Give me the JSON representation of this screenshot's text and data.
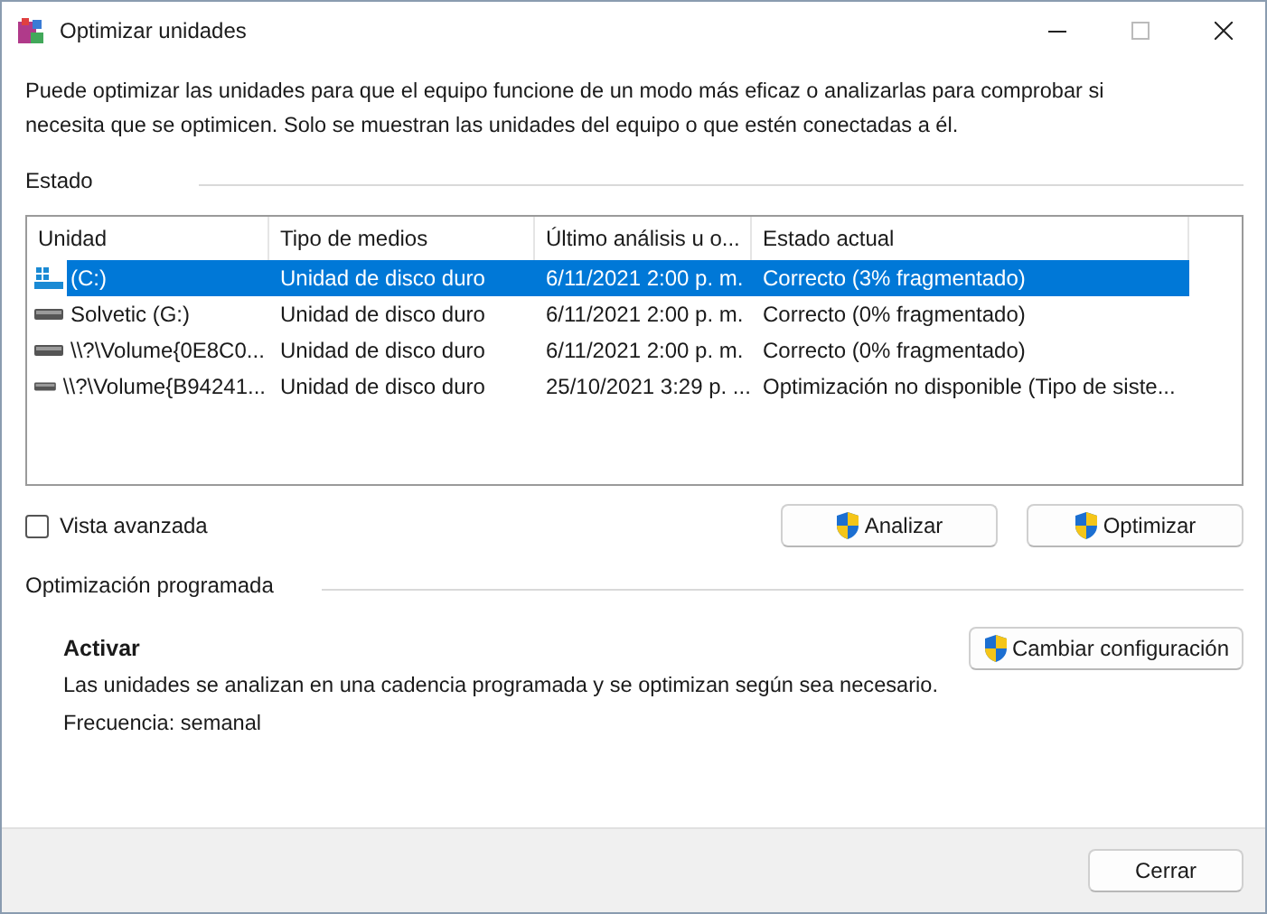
{
  "window": {
    "title": "Optimizar unidades"
  },
  "description": "Puede optimizar las unidades para que el equipo funcione de un modo más eficaz o analizarlas para comprobar si necesita que se optimicen. Solo se muestran las unidades del equipo o que estén conectadas a él.",
  "status_section": {
    "title": "Estado",
    "table": {
      "columns": [
        "Unidad",
        "Tipo de medios",
        "Último análisis u o...",
        "Estado actual"
      ],
      "rows": [
        {
          "kind": "system",
          "selected": true,
          "cells": [
            "(C:)",
            "Unidad de disco duro",
            "6/11/2021 2:00 p. m.",
            "Correcto (3% fragmentado)"
          ]
        },
        {
          "kind": "drive",
          "selected": false,
          "cells": [
            "Solvetic (G:)",
            "Unidad de disco duro",
            "6/11/2021 2:00 p. m.",
            "Correcto (0% fragmentado)"
          ]
        },
        {
          "kind": "drive",
          "selected": false,
          "cells": [
            "\\\\?\\Volume{0E8C0...",
            "Unidad de disco duro",
            "6/11/2021 2:00 p. m.",
            "Correcto (0% fragmentado)"
          ]
        },
        {
          "kind": "drive",
          "selected": false,
          "cells": [
            "\\\\?\\Volume{B94241...",
            "Unidad de disco duro",
            "25/10/2021 3:29 p. ...",
            "Optimización no disponible (Tipo de siste..."
          ]
        }
      ]
    },
    "advanced_view": {
      "label": "Vista avanzada",
      "checked": false
    },
    "buttons": [
      "Analizar",
      "Optimizar"
    ]
  },
  "scheduled_section": {
    "title": "Optimización programada",
    "state": "Activar",
    "button": "Cambiar configuración",
    "info": "Las unidades se analizan en una cadencia programada y se optimizan según sea necesario.",
    "frequency": "Frecuencia: semanal"
  },
  "footer": {
    "button": "Cerrar"
  }
}
